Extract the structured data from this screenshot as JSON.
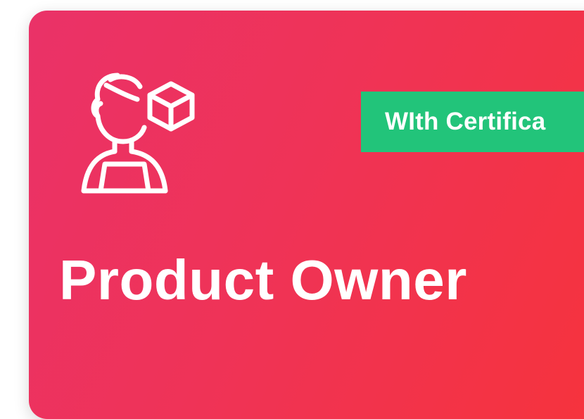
{
  "card": {
    "icon": "product-owner-person-with-box-icon",
    "badge_label": "WIth Certifica",
    "title": "Product Owner",
    "colors": {
      "gradient_start": "#ea3268",
      "gradient_end": "#f6333c",
      "badge": "#22c47a",
      "text": "#ffffff"
    }
  }
}
